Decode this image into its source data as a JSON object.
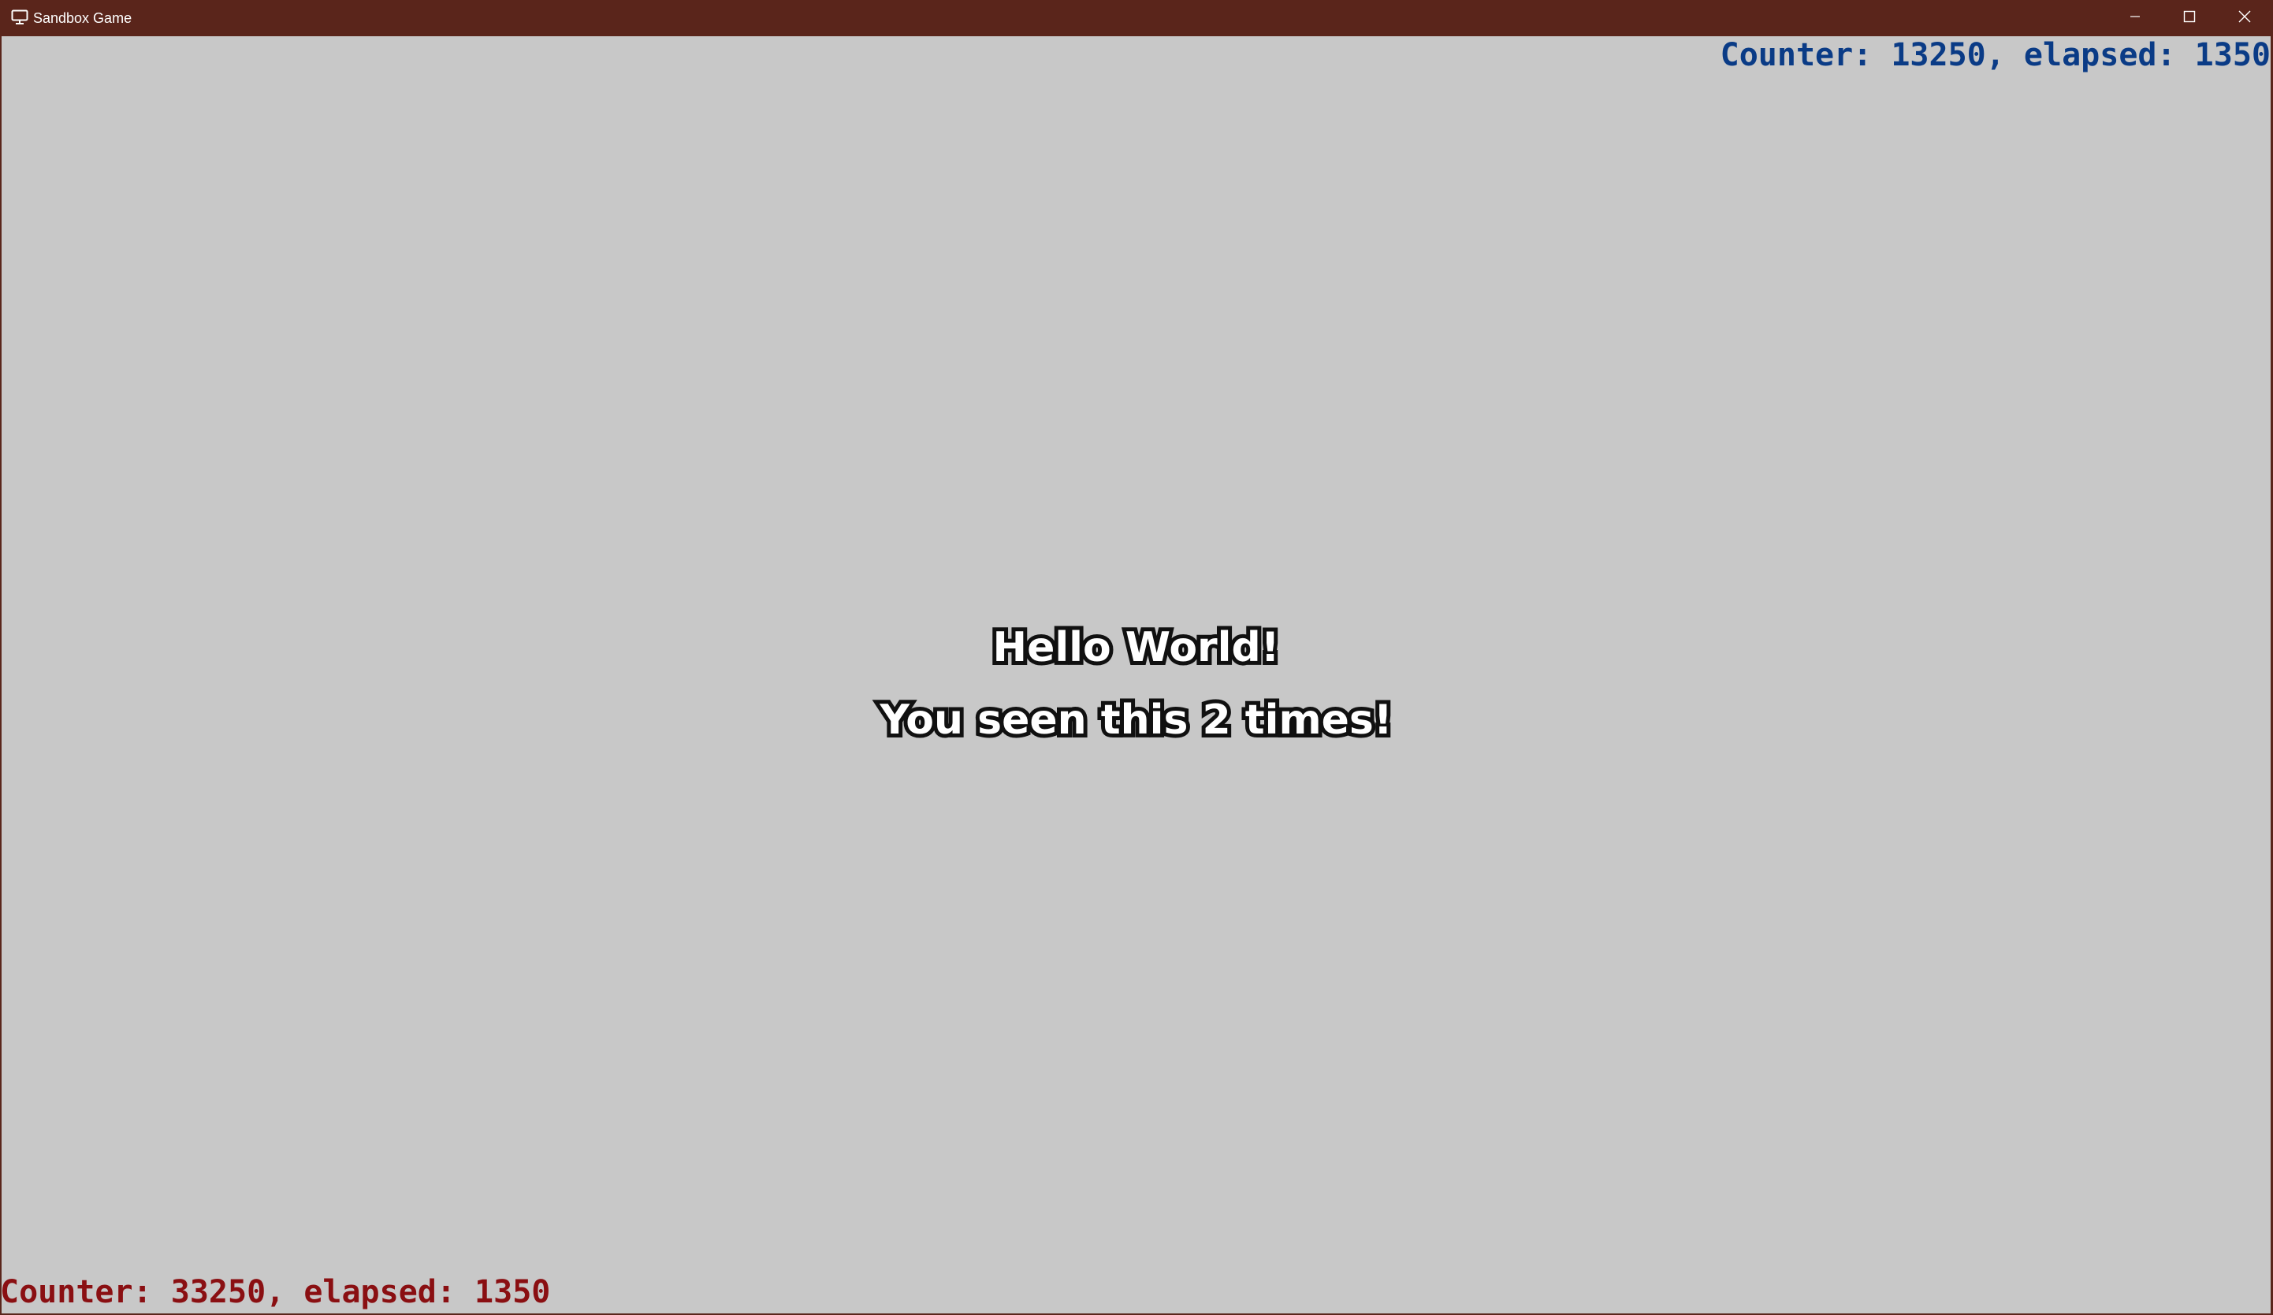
{
  "window": {
    "title": "Sandbox Game",
    "titlebar_color": "#5a251b",
    "background_color": "#c8c8c8",
    "icons": {
      "app": "monitor-icon",
      "minimize": "minimize-icon",
      "maximize": "maximize-icon",
      "close": "close-icon"
    }
  },
  "game": {
    "counter_top": {
      "text": "Counter: 13250, elapsed: 1350",
      "color": "#0a3b86"
    },
    "counter_bottom": {
      "text": "Counter: 33250, elapsed: 1350",
      "color": "#8a0f12"
    },
    "headline": "Hello World!",
    "subline": "You seen this 2 times!",
    "text_color": "#ffffff",
    "outline_color": "#111111"
  }
}
